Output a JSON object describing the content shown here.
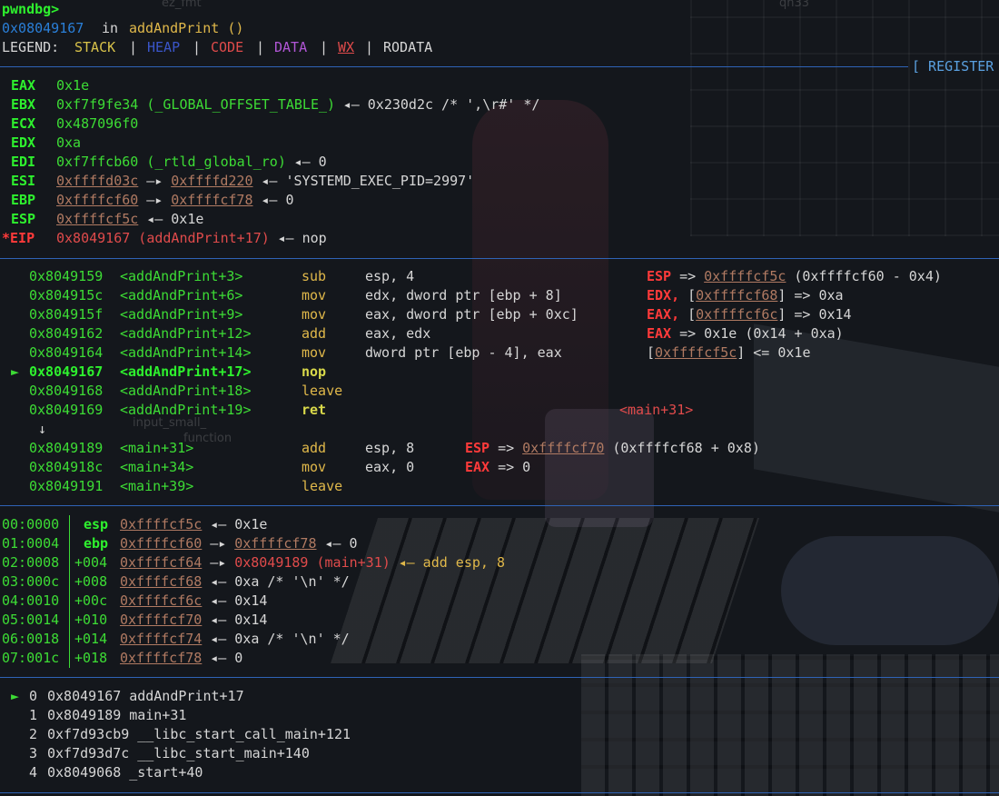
{
  "header": {
    "prompt": "pwndbg>",
    "location_addr": "0x08049167",
    "location_in": "in",
    "location_func": "addAndPrint ()",
    "legend_label": "LEGEND:",
    "legend": [
      "STACK",
      "HEAP",
      "CODE",
      "DATA",
      "WX",
      "RODATA"
    ],
    "sep_char": "|"
  },
  "registers_title": "[ REGISTER",
  "registers": [
    {
      "name": "EAX",
      "value": "0x1e",
      "rest": ""
    },
    {
      "name": "EBX",
      "value": "0xf7f9fe34 (_GLOBAL_OFFSET_TABLE_)",
      "rest": "◂— 0x230d2c /* ',\\r#' */"
    },
    {
      "name": "ECX",
      "value": "0x487096f0",
      "rest": ""
    },
    {
      "name": "EDX",
      "value": "0xa",
      "rest": ""
    },
    {
      "name": "EDI",
      "value": "0xf7ffcb60 (_rtld_global_ro)",
      "rest": "◂— 0"
    },
    {
      "name": "ESI",
      "ptr1": "0xffffd03c",
      "arrow": "—▸",
      "ptr2": "0xffffd220",
      "rest": "◂— 'SYSTEMD_EXEC_PID=2997'"
    },
    {
      "name": "EBP",
      "ptr1": "0xffffcf60",
      "arrow": "—▸",
      "ptr2": "0xffffcf78",
      "rest": "◂— 0"
    },
    {
      "name": "ESP",
      "ptr1": "0xffffcf5c",
      "rest": "◂— 0x1e"
    },
    {
      "name": "*EIP",
      "value": "0x8049167 (addAndPrint+17)",
      "rest": "◂— nop"
    }
  ],
  "disasm": [
    {
      "marker": "",
      "addr": "0x8049159",
      "sym": "<addAndPrint+3>",
      "mn": "sub",
      "ops": "esp, 4",
      "cmt_reg": "ESP",
      "cmt": "=> ",
      "cmt_ptr": "0xffffcf5c",
      "cmt_tail": "(0xffffcf60 - 0x4)"
    },
    {
      "marker": "",
      "addr": "0x804915c",
      "sym": "<addAndPrint+6>",
      "mn": "mov",
      "ops": "edx, dword ptr [ebp + 8]",
      "cmt_reg": "EDX,",
      "cmt": "[",
      "cmt_ptr": "0xffffcf68",
      "cmt_tail": "] => 0xa"
    },
    {
      "marker": "",
      "addr": "0x804915f",
      "sym": "<addAndPrint+9>",
      "mn": "mov",
      "ops": "eax, dword ptr [ebp + 0xc]",
      "cmt_reg": "EAX,",
      "cmt": "[",
      "cmt_ptr": "0xffffcf6c",
      "cmt_tail": "] => 0x14"
    },
    {
      "marker": "",
      "addr": "0x8049162",
      "sym": "<addAndPrint+12>",
      "mn": "add",
      "ops": "eax, edx",
      "cmt_reg": "EAX",
      "cmt": "=> 0x1e (0x14 + 0xa)",
      "cmt_ptr": "",
      "cmt_tail": ""
    },
    {
      "marker": "",
      "addr": "0x8049164",
      "sym": "<addAndPrint+14>",
      "mn": "mov",
      "ops": "dword ptr [ebp - 4], eax",
      "cmt_reg": "",
      "cmt": "[",
      "cmt_ptr": "0xffffcf5c",
      "cmt_tail": "] <= 0x1e"
    },
    {
      "marker": "►",
      "addr": "0x8049167",
      "sym": "<addAndPrint+17>",
      "mn": "nop",
      "ops": "",
      "cmt_reg": "",
      "cmt": "",
      "cmt_ptr": "",
      "cmt_tail": ""
    },
    {
      "marker": "",
      "addr": "0x8049168",
      "sym": "<addAndPrint+18>",
      "mn": "leave",
      "ops": "",
      "cmt_reg": "",
      "cmt": "",
      "cmt_ptr": "",
      "cmt_tail": ""
    },
    {
      "marker": "",
      "addr": "0x8049169",
      "sym": "<addAndPrint+19>",
      "mn": "ret",
      "ops": "",
      "cmt_reg": "",
      "cmt": "<main+31>",
      "cmt_ptr": "",
      "cmt_tail": ""
    }
  ],
  "disasm_down_arrow": "↓",
  "disasm2": [
    {
      "addr": "0x8049189",
      "sym": "<main+31>",
      "mn": "add",
      "ops": "esp, 8",
      "cmt_reg": "ESP",
      "cmt": "=> ",
      "cmt_ptr": "0xffffcf70",
      "cmt_tail": "(0xffffcf68 + 0x8)"
    },
    {
      "addr": "0x804918c",
      "sym": "<main+34>",
      "mn": "mov",
      "ops": "eax, 0",
      "cmt_reg": "EAX",
      "cmt": "=> 0",
      "cmt_ptr": "",
      "cmt_tail": ""
    },
    {
      "addr": "0x8049191",
      "sym": "<main+39>",
      "mn": "leave",
      "ops": "",
      "cmt_reg": "",
      "cmt": "",
      "cmt_ptr": "",
      "cmt_tail": ""
    }
  ],
  "stack": [
    {
      "idx": "00:0000",
      "off": "esp",
      "ptr": "0xffffcf5c",
      "arrow": "",
      "ptr2": "",
      "tail": "◂— 0x1e"
    },
    {
      "idx": "01:0004",
      "off": "ebp",
      "ptr": "0xffffcf60",
      "arrow": "—▸",
      "ptr2": "0xffffcf78",
      "tail": "◂— 0"
    },
    {
      "idx": "02:0008",
      "off": "+004",
      "ptr": "0xffffcf64",
      "arrow": "—▸",
      "code": "0x8049189 (main+31)",
      "tail": "◂— add esp, 8"
    },
    {
      "idx": "03:000c",
      "off": "+008",
      "ptr": "0xffffcf68",
      "arrow": "",
      "ptr2": "",
      "tail": "◂— 0xa /* '\\n' */"
    },
    {
      "idx": "04:0010",
      "off": "+00c",
      "ptr": "0xffffcf6c",
      "arrow": "",
      "ptr2": "",
      "tail": "◂— 0x14"
    },
    {
      "idx": "05:0014",
      "off": "+010",
      "ptr": "0xffffcf70",
      "arrow": "",
      "ptr2": "",
      "tail": "◂— 0x14"
    },
    {
      "idx": "06:0018",
      "off": "+014",
      "ptr": "0xffffcf74",
      "arrow": "",
      "ptr2": "",
      "tail": "◂— 0xa /* '\\n' */"
    },
    {
      "idx": "07:001c",
      "off": "+018",
      "ptr": "0xffffcf78",
      "arrow": "",
      "ptr2": "",
      "tail": "◂— 0"
    }
  ],
  "backtrace": [
    {
      "marker": "►",
      "n": "0",
      "addr": "0x8049167",
      "sym": "addAndPrint+17"
    },
    {
      "marker": "",
      "n": "1",
      "addr": "0x8049189",
      "sym": "main+31"
    },
    {
      "marker": "",
      "n": "2",
      "addr": "0xf7d93cb9",
      "sym": "__libc_start_call_main+121"
    },
    {
      "marker": "",
      "n": "3",
      "addr": "0xf7d93d7c",
      "sym": "__libc_start_main+140"
    },
    {
      "marker": "",
      "n": "4",
      "addr": "0x8049068",
      "sym": "_start+40"
    }
  ],
  "desktop_ghosts": [
    "ez_fmt",
    "qn33",
    "input_small_",
    "function"
  ]
}
